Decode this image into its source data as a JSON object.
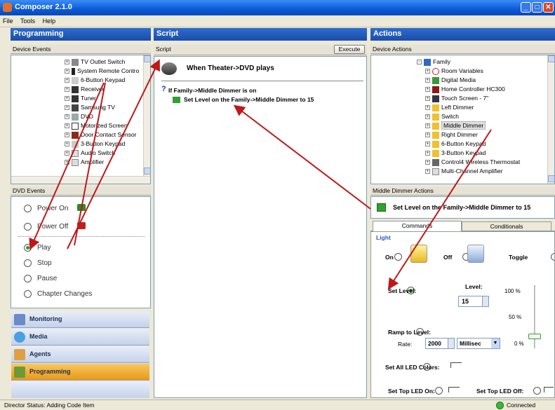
{
  "window": {
    "title": "Composer 2.1.0"
  },
  "menu": [
    "File",
    "Tools",
    "Help"
  ],
  "programming": {
    "header": "Programming",
    "device_events_label": "Device Events",
    "devices": [
      "TV Outlet Switch",
      "System Remote Contro",
      "6-Button Keypad",
      "Receiver",
      "Tuner",
      "Samsung TV",
      "DVD",
      "Motorized Screen",
      "Door Contact Sensor",
      "3-Button Keypad",
      "Audio Switch",
      "Amplifier"
    ],
    "dvd_events_label": "DVD Events",
    "events": [
      "Power On",
      "Power Off",
      "Play",
      "Stop",
      "Pause",
      "Chapter Changes"
    ],
    "selected_event": "Play",
    "nav": [
      "Monitoring",
      "Media",
      "Agents",
      "Programming"
    ]
  },
  "script": {
    "header": "Script",
    "sub": "Script",
    "execute_label": "Execute",
    "event_title": "When Theater->DVD plays",
    "if_line": "If Family->Middle Dimmer is on",
    "action_line": "Set Level on the Family->Middle Dimmer to 15"
  },
  "actions": {
    "header": "Actions",
    "device_actions_label": "Device Actions",
    "tree": [
      "Family",
      "Room Variables",
      "Digital Media",
      "Home Controller HC300",
      "Touch Screen - 7\"",
      "Left Dimmer",
      "Switch",
      "Middle Dimmer",
      "Right Dimmer",
      "6-Button Keypad",
      "3-Button Keypad",
      "Control4 Wireless Thermostat",
      "Multi-Channel Amplifier"
    ],
    "middle_dimmer_actions_label": "Middle Dimmer Actions",
    "drag_line": "Set Level on the Family->Middle Dimmer to 15",
    "tabs": [
      "Commands",
      "Conditionals"
    ],
    "light_label": "Light",
    "on_label": "On",
    "off_label": "Off",
    "toggle_label": "Toggle",
    "set_level_label": "Set Level:",
    "level_label": "Level:",
    "level_value": "15",
    "slider_ticks": [
      "100 %",
      "50 %",
      "0 %"
    ],
    "ramp_label": "Ramp to Level:",
    "rate_label": "Rate:",
    "rate_value": "2000",
    "rate_unit": "Millisec",
    "set_all_led": "Set All LED Colors:",
    "set_top_led_on": "Set Top LED On:",
    "set_top_led_off": "Set Top LED Off:"
  },
  "status": {
    "text": "Director Status: Adding Code Item",
    "connected": "Connected"
  },
  "colors": {
    "title_bar": "#0A5AD8",
    "panel_header": "#1C4CA8",
    "arrow": "#C01818",
    "programming_nav": "#F0A020"
  }
}
